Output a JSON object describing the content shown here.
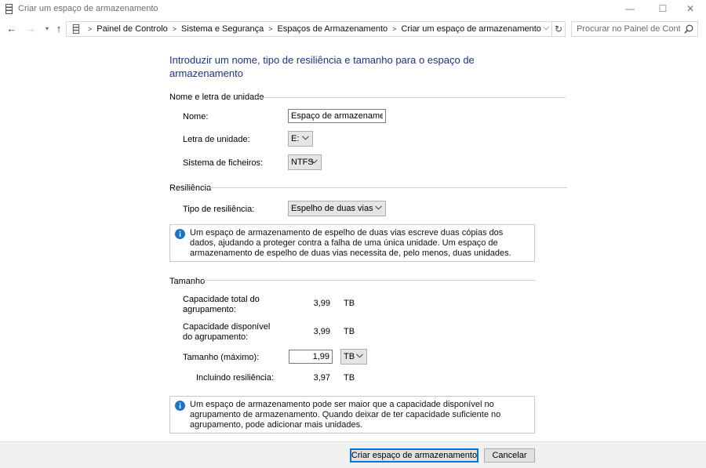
{
  "window": {
    "title": "Criar um espaço de armazenamento",
    "controls": {
      "minimize": "—",
      "maximize": "☐",
      "close": "✕"
    }
  },
  "nav": {
    "breadcrumbs": [
      "Painel de Controlo",
      "Sistema e Segurança",
      "Espaços de Armazenamento",
      "Criar um espaço de armazenamento"
    ],
    "search_placeholder": "Procurar no Painel de Controlo"
  },
  "page": {
    "heading": "Introduzir um nome, tipo de resiliência e tamanho para o espaço de armazenamento"
  },
  "name_section": {
    "title": "Nome e letra de unidade",
    "name_label": "Nome:",
    "name_value": "Espaço de armazenamento",
    "drive_label": "Letra de unidade:",
    "drive_value": "E:",
    "fs_label": "Sistema de ficheiros:",
    "fs_value": "NTFS"
  },
  "resiliency_section": {
    "title": "Resiliência",
    "type_label": "Tipo de resiliência:",
    "type_value": "Espelho de duas vias",
    "info": "Um espaço de armazenamento de espelho de duas vias escreve duas cópias dos dados, ajudando a proteger contra a falha de uma única unidade. Um espaço de armazenamento de espelho de duas vias necessita de, pelo menos, duas unidades."
  },
  "size_section": {
    "title": "Tamanho",
    "total_label": "Capacidade total do agrupamento:",
    "total_value": "3,99",
    "total_unit": "TB",
    "available_label": "Capacidade disponível do agrupamento:",
    "available_value": "3,99",
    "available_unit": "TB",
    "size_label": "Tamanho (máximo):",
    "size_value": "1,99",
    "size_unit": "TB",
    "incl_label": "Incluindo resiliência:",
    "incl_value": "3,97",
    "incl_unit": "TB",
    "info": "Um espaço de armazenamento pode ser maior que a capacidade disponível no agrupamento de armazenamento. Quando deixar de ter capacidade suficiente no agrupamento, pode adicionar mais unidades."
  },
  "footer": {
    "create_label": "Criar espaço de armazenamento",
    "cancel_label": "Cancelar"
  },
  "colors": {
    "heading": "#1e3287",
    "info_icon": "#1a73c9",
    "primary_border": "#0078d7"
  }
}
